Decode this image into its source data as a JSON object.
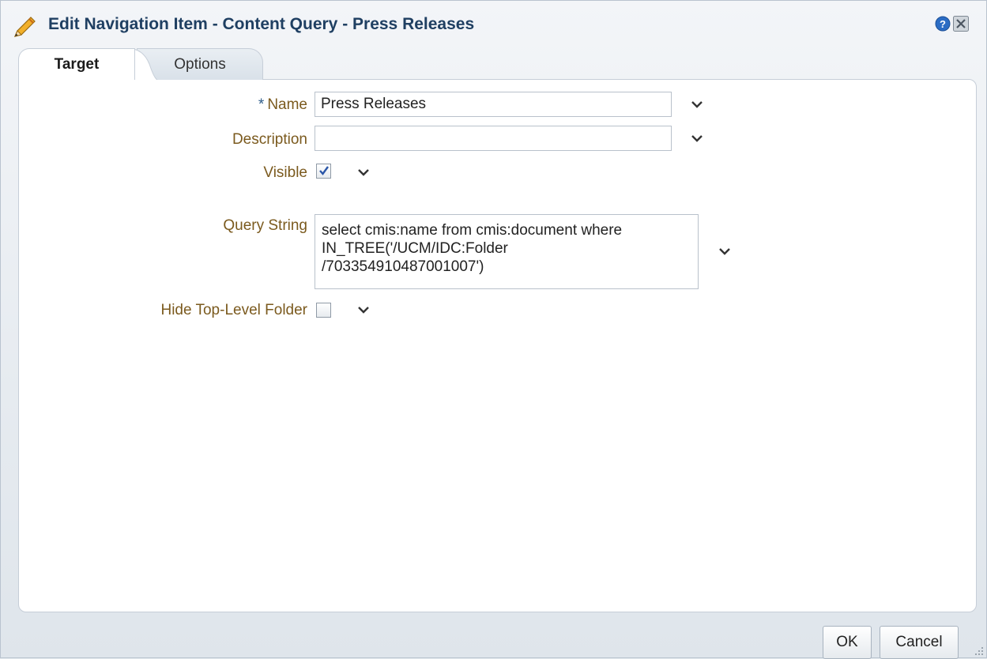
{
  "dialog": {
    "title": "Edit Navigation Item - Content Query - Press Releases"
  },
  "tabs": [
    {
      "label": "Target",
      "selected": true
    },
    {
      "label": "Options",
      "selected": false
    }
  ],
  "form": {
    "name": {
      "label": "Name",
      "required_marker": "*",
      "value": "Press Releases"
    },
    "description": {
      "label": "Description",
      "value": ""
    },
    "visible": {
      "label": "Visible",
      "checked": true
    },
    "query_string": {
      "label": "Query String",
      "value": "select cmis:name from cmis:document where\nIN_TREE('/UCM/IDC:Folder\n/703354910487001007')"
    },
    "hide_top_level_folder": {
      "label": "Hide Top-Level Folder",
      "checked": false
    }
  },
  "buttons": {
    "ok": "OK",
    "cancel": "Cancel"
  },
  "icons": {
    "title": "pencil-icon",
    "help": "help-icon",
    "close": "close-icon",
    "field_menu": "chevron-down-icon",
    "resize": "resize-grip-icon"
  },
  "colors": {
    "title_text": "#1f3f62",
    "label_text": "#7b5a1e",
    "required_marker": "#2f5d8a",
    "help_icon": "#2b6cc4"
  }
}
